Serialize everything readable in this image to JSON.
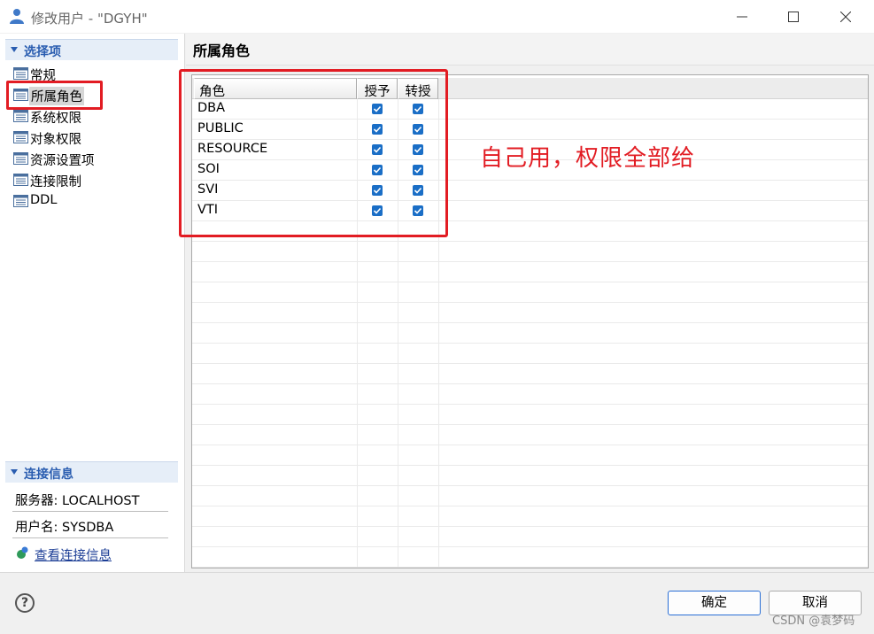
{
  "window": {
    "title": "修改用户 - \"DGYH\"",
    "icon": "user-icon"
  },
  "sidebar": {
    "section_title": "选择项",
    "items": [
      {
        "label": "常规",
        "icon": "list-icon"
      },
      {
        "label": "所属角色",
        "icon": "list-icon",
        "selected": true
      },
      {
        "label": "系统权限",
        "icon": "list-icon"
      },
      {
        "label": "对象权限",
        "icon": "list-icon"
      },
      {
        "label": "资源设置项",
        "icon": "list-icon"
      },
      {
        "label": "连接限制",
        "icon": "list-icon"
      },
      {
        "label": "DDL",
        "icon": "list-icon"
      }
    ]
  },
  "connection": {
    "section_title": "连接信息",
    "server": "服务器: LOCALHOST",
    "user": "用户名: SYSDBA",
    "link_label": "查看连接信息"
  },
  "main": {
    "title": "所属角色",
    "columns": [
      "角色",
      "授予",
      "转授"
    ],
    "rows": [
      {
        "role": "DBA",
        "grant": true,
        "transfer": true
      },
      {
        "role": "PUBLIC",
        "grant": true,
        "transfer": true
      },
      {
        "role": "RESOURCE",
        "grant": true,
        "transfer": true
      },
      {
        "role": "SOI",
        "grant": true,
        "transfer": true
      },
      {
        "role": "SVI",
        "grant": true,
        "transfer": true
      },
      {
        "role": "VTI",
        "grant": true,
        "transfer": true
      }
    ],
    "annotation": "自己用，权限全部给"
  },
  "footer": {
    "help": "?",
    "ok_label": "确定",
    "cancel_label": "取消",
    "watermark": "CSDN @袁梦码"
  },
  "colors": {
    "accent": "#2a5db0",
    "annotation_red": "#e21c23",
    "checkbox_blue": "#1a6ec6",
    "link": "#1b3d95"
  }
}
